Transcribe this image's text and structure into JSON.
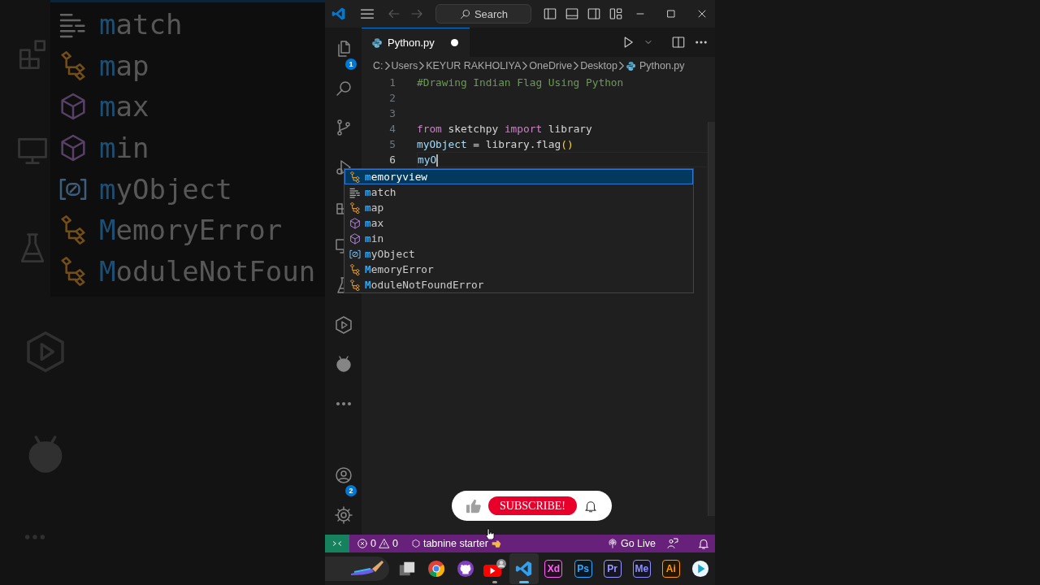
{
  "backdrop": {
    "suggestions": [
      {
        "kind": "keyword",
        "match": "m",
        "rest": "atch"
      },
      {
        "kind": "class",
        "match": "m",
        "rest": "ap"
      },
      {
        "kind": "function",
        "match": "m",
        "rest": "ax"
      },
      {
        "kind": "function",
        "match": "m",
        "rest": "in"
      },
      {
        "kind": "variable",
        "match": "m",
        "rest": "yObject"
      },
      {
        "kind": "class",
        "match": "M",
        "rest": "emoryError"
      },
      {
        "kind": "class",
        "match": "M",
        "rest": "oduleNotFoun"
      }
    ]
  },
  "titlebar": {
    "search": "Search"
  },
  "activity_bar": {
    "explorer_badge": "1",
    "accounts_badge": "2"
  },
  "tabs": [
    {
      "label": "Python.py",
      "selected": true,
      "modified": true
    }
  ],
  "breadcrumbs": [
    {
      "label": "C:",
      "kind": "folder"
    },
    {
      "label": "Users",
      "kind": "folder"
    },
    {
      "label": "KEYUR RAKHOLIYA",
      "kind": "folder"
    },
    {
      "label": "OneDrive",
      "kind": "folder"
    },
    {
      "label": "Desktop",
      "kind": "folder"
    },
    {
      "label": "Python.py",
      "kind": "file"
    }
  ],
  "code_lines": [
    {
      "number": "1",
      "current": false,
      "tokens": [
        {
          "kind": "comment",
          "text": "#Drawing Indian Flag Using Python"
        }
      ]
    },
    {
      "number": "2",
      "current": false
    },
    {
      "number": "3",
      "current": false
    },
    {
      "number": "4",
      "current": false,
      "tokens": [
        {
          "kind": "keyword",
          "text": "from"
        },
        {
          "kind": "plain",
          "text": " sketchpy "
        },
        {
          "kind": "keyword",
          "text": "import"
        },
        {
          "kind": "plain",
          "text": " library"
        }
      ]
    },
    {
      "number": "5",
      "current": false,
      "tokens": [
        {
          "kind": "variable",
          "text": "myObject"
        },
        {
          "kind": "plain",
          "text": " = library.flag"
        },
        {
          "kind": "bracket",
          "text": "()"
        }
      ]
    },
    {
      "number": "6",
      "current": true,
      "tokens": [
        {
          "kind": "variable",
          "text": "myO"
        }
      ]
    }
  ],
  "suggestions": [
    {
      "kind": "class",
      "match": "m",
      "rest": "emoryview",
      "selected": true
    },
    {
      "kind": "keyword",
      "match": "m",
      "rest": "atch",
      "selected": false
    },
    {
      "kind": "class",
      "match": "m",
      "rest": "ap",
      "selected": false
    },
    {
      "kind": "function",
      "match": "m",
      "rest": "ax",
      "selected": false
    },
    {
      "kind": "function",
      "match": "m",
      "rest": "in",
      "selected": false
    },
    {
      "kind": "variable",
      "match": "m",
      "rest": "yObject",
      "selected": false
    },
    {
      "kind": "class",
      "match": "M",
      "rest": "emoryError",
      "selected": false
    },
    {
      "kind": "class",
      "match": "M",
      "rest": "oduleNotFoundError",
      "selected": false
    }
  ],
  "overlay": {
    "button": "SUBSCRIBE!"
  },
  "status_bar": {
    "errors": "0",
    "warnings": "0",
    "tabnine": "tabnine starter",
    "go_live": "Go Live"
  },
  "taskbar": [
    {
      "kind": "brush",
      "running": false,
      "selected": false
    },
    {
      "kind": "windows",
      "running": false,
      "selected": false
    },
    {
      "kind": "chrome",
      "running": false,
      "selected": false
    },
    {
      "kind": "github",
      "running": false,
      "selected": false
    },
    {
      "kind": "youtube",
      "running": true,
      "selected": false
    },
    {
      "kind": "vscode",
      "running": true,
      "selected": true
    },
    {
      "kind": "letters",
      "label": "Xd",
      "color": "#ff61f6",
      "running": false,
      "selected": false
    },
    {
      "kind": "letters",
      "label": "Ps",
      "color": "#31a8ff",
      "running": false,
      "selected": false
    },
    {
      "kind": "letters",
      "label": "Pr",
      "color": "#9999ff",
      "running": false,
      "selected": false
    },
    {
      "kind": "letters",
      "label": "Me",
      "color": "#8f8fff",
      "running": false,
      "selected": false
    },
    {
      "kind": "letters",
      "label": "Ai",
      "color": "#ff9a00",
      "running": false,
      "selected": false
    },
    {
      "kind": "play",
      "running": false,
      "selected": false
    }
  ]
}
